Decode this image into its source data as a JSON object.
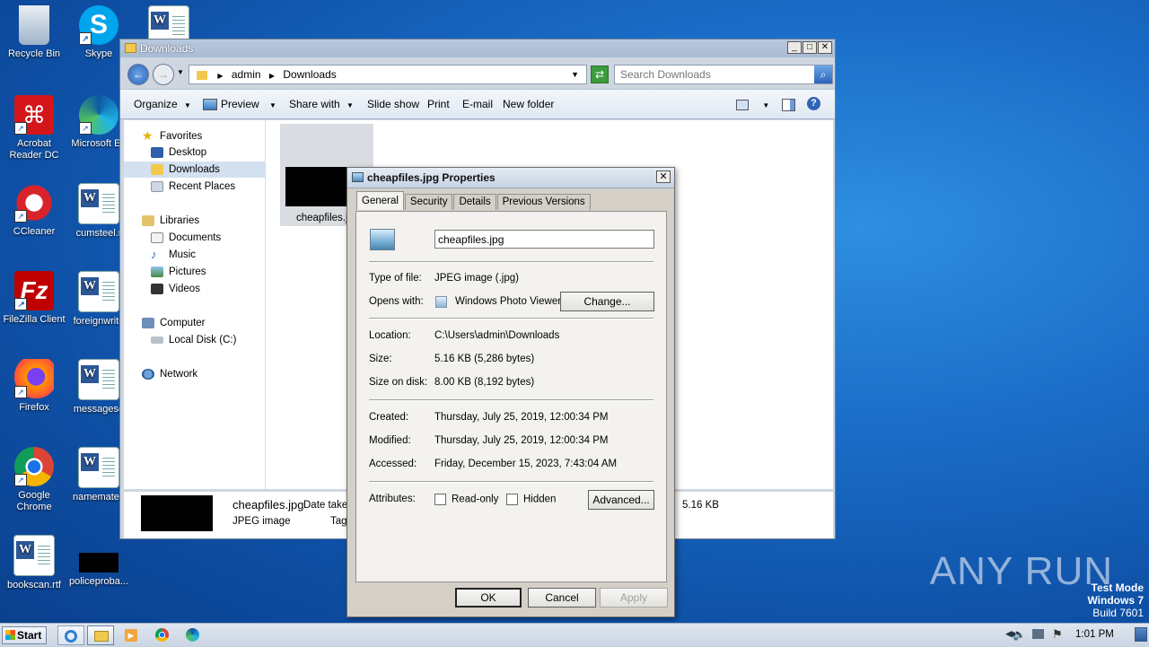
{
  "desktop": {
    "icons": [
      {
        "label": "Recycle Bin"
      },
      {
        "label": "Skype"
      },
      {
        "label": "Acrobat Reader DC"
      },
      {
        "label": "Microsoft Ed"
      },
      {
        "label": "CCleaner"
      },
      {
        "label": "cumsteel.r"
      },
      {
        "label": "FileZilla Client"
      },
      {
        "label": "foreignwrite"
      },
      {
        "label": "Firefox"
      },
      {
        "label": "messagesd"
      },
      {
        "label": "Google Chrome"
      },
      {
        "label": "namemateri"
      },
      {
        "label": "bookscan.rtf"
      },
      {
        "label": "policeproba..."
      }
    ]
  },
  "explorer": {
    "title": "Downloads",
    "breadcrumb": [
      "admin",
      "Downloads"
    ],
    "search_placeholder": "Search Downloads",
    "toolbar": {
      "organize": "Organize",
      "preview": "Preview",
      "share_with": "Share with",
      "slide_show": "Slide show",
      "print": "Print",
      "email": "E-mail",
      "new_folder": "New folder"
    },
    "nav": {
      "favorites": "Favorites",
      "desktop": "Desktop",
      "downloads": "Downloads",
      "recent_places": "Recent Places",
      "libraries": "Libraries",
      "documents": "Documents",
      "music": "Music",
      "pictures": "Pictures",
      "videos": "Videos",
      "computer": "Computer",
      "local_disk": "Local Disk (C:)",
      "network": "Network"
    },
    "file": {
      "name": "cheapfiles.jp"
    },
    "details": {
      "filename": "cheapfiles.jpg",
      "date_taken_label": "Date taken",
      "type": "JPEG image",
      "tags_label": "Tag",
      "size": "5.16 KB"
    }
  },
  "properties": {
    "title": "cheapfiles.jpg Properties",
    "tabs": [
      "General",
      "Security",
      "Details",
      "Previous Versions"
    ],
    "filename_value": "cheapfiles.jpg",
    "type_label": "Type of file:",
    "type_value": "JPEG image (.jpg)",
    "opens_label": "Opens with:",
    "opens_value": "Windows Photo Viewer",
    "change_button": "Change...",
    "location_label": "Location:",
    "location_value": "C:\\Users\\admin\\Downloads",
    "size_label": "Size:",
    "size_value": "5.16 KB (5,286 bytes)",
    "size_on_disk_label": "Size on disk:",
    "size_on_disk_value": "8.00 KB (8,192 bytes)",
    "created_label": "Created:",
    "created_value": "Thursday, July 25, 2019, 12:00:34 PM",
    "modified_label": "Modified:",
    "modified_value": "Thursday, July 25, 2019, 12:00:34 PM",
    "accessed_label": "Accessed:",
    "accessed_value": "Friday, December 15, 2023, 7:43:04 AM",
    "attributes_label": "Attributes:",
    "readonly_label": "Read-only",
    "hidden_label": "Hidden",
    "advanced_button": "Advanced...",
    "ok_button": "OK",
    "cancel_button": "Cancel",
    "apply_button": "Apply"
  },
  "taskbar": {
    "start_label": "Start",
    "clock": "1:01 PM"
  },
  "watermark": "ANY RUN",
  "test_mode": {
    "line1": "Test Mode",
    "line2": "Windows 7",
    "line3": "Build 7601"
  }
}
